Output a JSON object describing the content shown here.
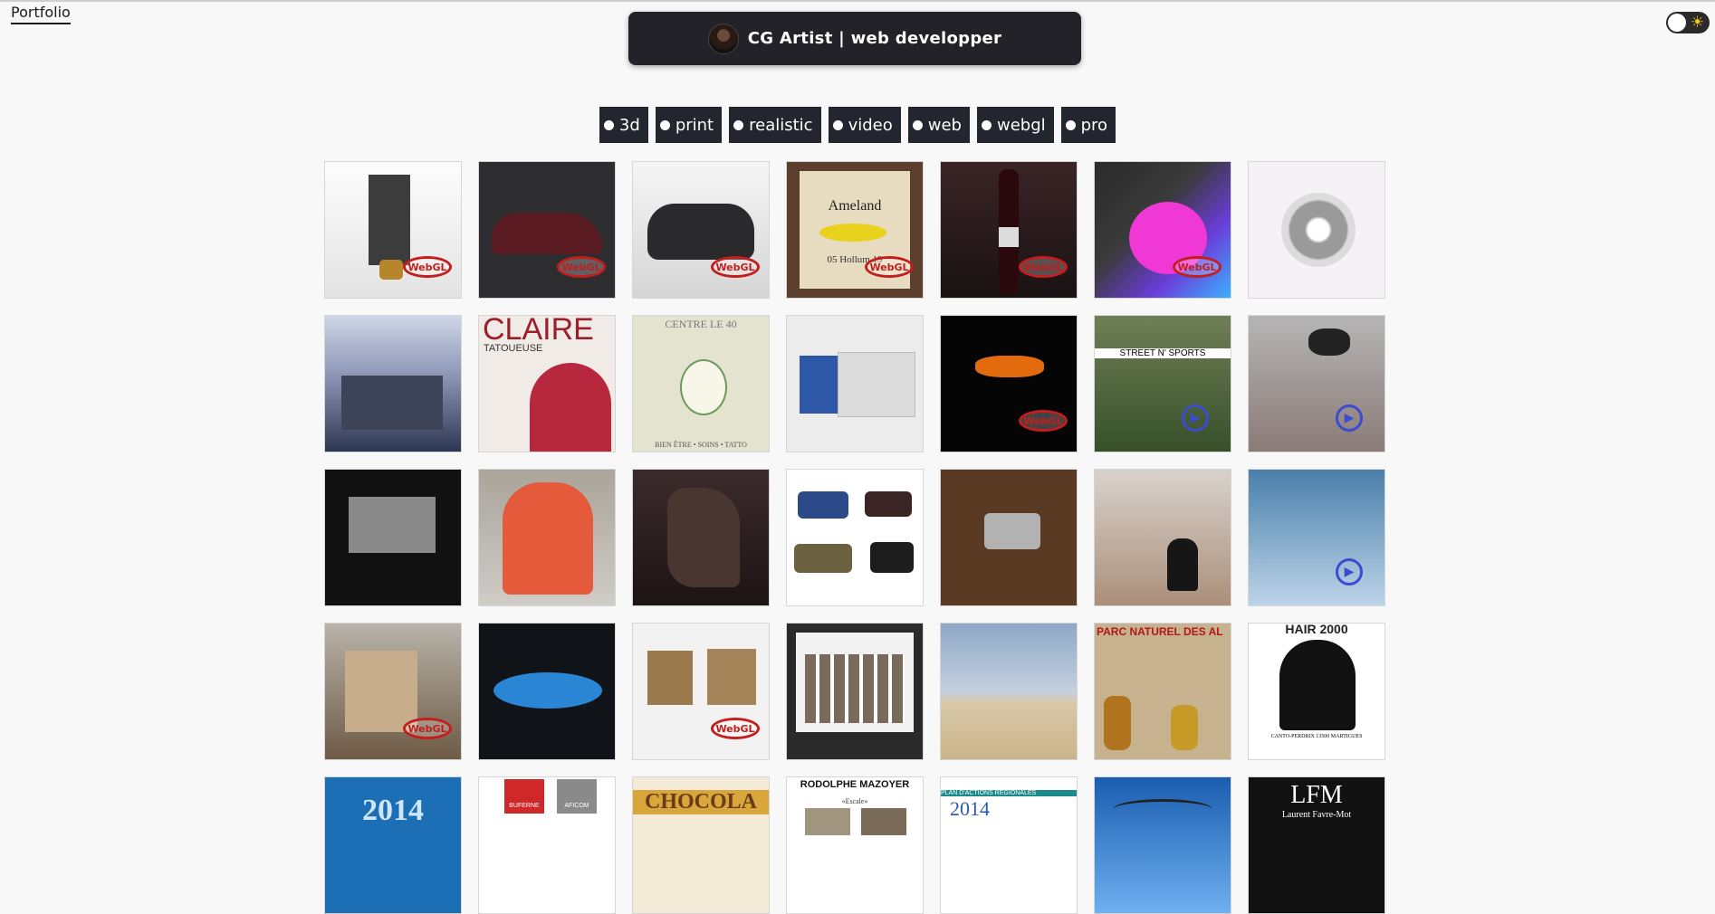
{
  "nav": {
    "portfolio_label": "Portfolio"
  },
  "header": {
    "title": "CG Artist | web developper",
    "avatar_icon": "avatar-photo"
  },
  "theme_toggle": {
    "icon": "sun-icon",
    "state": "light"
  },
  "filters": [
    "3d",
    "print",
    "realistic",
    "video",
    "web",
    "webgl",
    "pro"
  ],
  "badges": {
    "webgl": "WebGL",
    "play_icon": "play-icon"
  },
  "tile_texts": {
    "ameland_title": "Ameland",
    "ameland_sub": "05 Hollum 19",
    "claire_title": "CLAIRE",
    "claire_sub": "TATOUEUSE",
    "centre_title": "CENTRE LE 40",
    "centre_footer": "BIEN ÊTRE • SOINS • TATTO",
    "street_sign": "STREET N' SPORTS",
    "parc_title": "PARC NATUREL DES AL",
    "hair_title": "HAIR 2000",
    "hair_footer": "CANTO-PERDRIX 13500 MARTIGUES",
    "year_2014_a": "2014",
    "buferne_label": "BUFERNE",
    "aficom_label": "AFICOM",
    "chocolat_title": "CHOCOLA",
    "mazoyer_title": "RODOLPHE MAZOYER",
    "mazoyer_sub": "«Escale»",
    "plan_title": "PLAN D'ACTIONS RÉGIONALES",
    "year_2014_b": "2014",
    "lfm_title": "LFM",
    "lfm_sub": "Laurent Favre-Mot"
  },
  "colors": {
    "banner": "#222228",
    "filter_bg": "#23262e",
    "webgl_red": "#c41d1d",
    "play_blue": "#3d4bd0"
  }
}
